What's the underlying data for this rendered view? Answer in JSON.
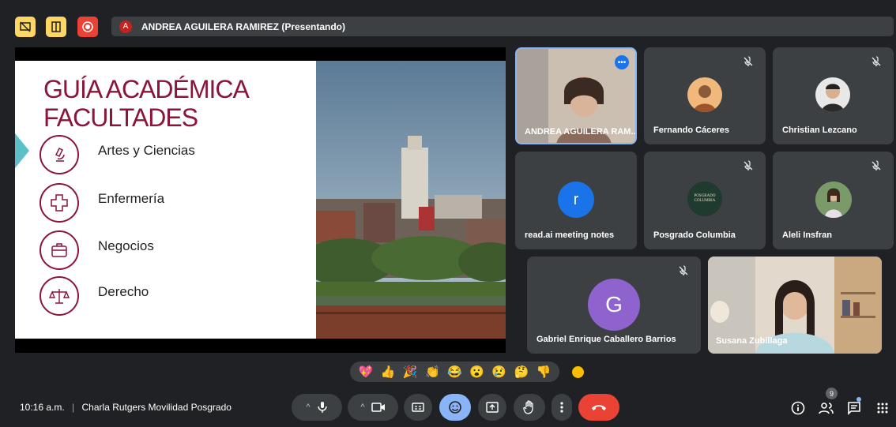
{
  "top_bar": {
    "icons": [
      "screen-off-icon",
      "layout-icon",
      "record-icon"
    ],
    "presenter_initial": "A",
    "presenter_label": "ANDREA AGUILERA RAMIREZ (Presentando)"
  },
  "slide": {
    "title_line1": "GUÍA ACADÉMICA",
    "title_line2": "FACULTADES",
    "items": [
      {
        "label": "Artes y Ciencias",
        "icon": "microscope-icon"
      },
      {
        "label": "Enfermería",
        "icon": "medical-cross-icon"
      },
      {
        "label": "Negocios",
        "icon": "briefcase-icon"
      },
      {
        "label": "Derecho",
        "icon": "scales-icon"
      }
    ],
    "colors": {
      "title": "#8a1538",
      "accent": "#5bc0c8"
    }
  },
  "participants": [
    {
      "name": "ANDREA AGUILERA RAM...",
      "type": "video",
      "muted": false,
      "active": true
    },
    {
      "name": "Fernando Cáceres",
      "type": "avatar",
      "muted": true
    },
    {
      "name": "Christian Lezcano",
      "type": "avatar",
      "muted": true
    },
    {
      "name": "read.ai meeting notes",
      "type": "letter",
      "initial": "r",
      "color": "#1a73e8",
      "muted": false
    },
    {
      "name": "Posgrado Columbia",
      "type": "logo",
      "logo_text": "POSGRADO COLUMBIA",
      "muted": true
    },
    {
      "name": "Aleli Insfran",
      "type": "avatar",
      "muted": true
    },
    {
      "name": "Gabriel Enrique Caballero Barrios",
      "type": "letter",
      "initial": "G",
      "color": "#8e63ce",
      "muted": true
    },
    {
      "name": "Susana Zubillaga",
      "type": "video",
      "muted": false
    }
  ],
  "reactions": [
    "💖",
    "👍",
    "🎉",
    "👏",
    "😂",
    "😮",
    "😢",
    "🤔",
    "👎"
  ],
  "bottom_bar": {
    "time": "10:16 a.m.",
    "separator": "|",
    "meeting_name": "Charla Rutgers Movilidad Posgrado",
    "people_count": "9"
  }
}
